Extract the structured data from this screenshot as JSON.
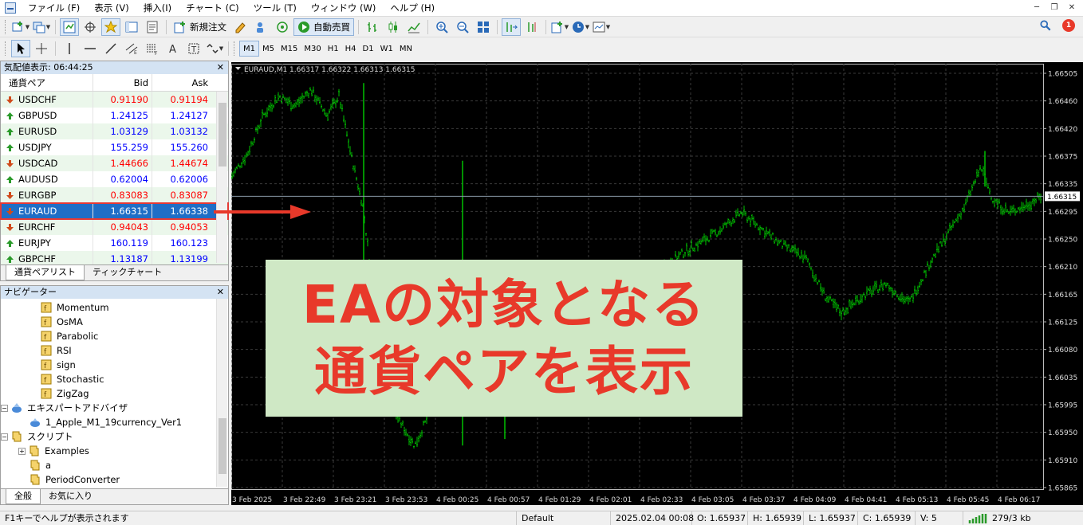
{
  "menubar": {
    "items": [
      "ファイル (F)",
      "表示 (V)",
      "挿入(I)",
      "チャート (C)",
      "ツール (T)",
      "ウィンドウ (W)",
      "ヘルプ (H)"
    ]
  },
  "toolbar": {
    "new_order_label": "新規注文",
    "auto_trade_label": "自動売買",
    "timeframes": [
      "M1",
      "M5",
      "M15",
      "M30",
      "H1",
      "H4",
      "D1",
      "W1",
      "MN"
    ],
    "active_timeframe": "M1",
    "alert_count": "1"
  },
  "market_watch": {
    "title": "気配値表示: 06:44:25",
    "columns": {
      "symbol": "通貨ペア",
      "bid": "Bid",
      "ask": "Ask"
    },
    "rows": [
      {
        "symbol": "USDCHF",
        "bid": "0.91190",
        "ask": "0.91194",
        "dir": "down"
      },
      {
        "symbol": "GBPUSD",
        "bid": "1.24125",
        "ask": "1.24127",
        "dir": "up"
      },
      {
        "symbol": "EURUSD",
        "bid": "1.03129",
        "ask": "1.03132",
        "dir": "up"
      },
      {
        "symbol": "USDJPY",
        "bid": "155.259",
        "ask": "155.260",
        "dir": "up"
      },
      {
        "symbol": "USDCAD",
        "bid": "1.44666",
        "ask": "1.44674",
        "dir": "down"
      },
      {
        "symbol": "AUDUSD",
        "bid": "0.62004",
        "ask": "0.62006",
        "dir": "up"
      },
      {
        "symbol": "EURGBP",
        "bid": "0.83083",
        "ask": "0.83087",
        "dir": "down"
      },
      {
        "symbol": "EURAUD",
        "bid": "1.66315",
        "ask": "1.66338",
        "dir": "down",
        "selected": true
      },
      {
        "symbol": "EURCHF",
        "bid": "0.94043",
        "ask": "0.94053",
        "dir": "down"
      },
      {
        "symbol": "EURJPY",
        "bid": "160.119",
        "ask": "160.123",
        "dir": "up"
      },
      {
        "symbol": "GBPCHF",
        "bid": "1.13187",
        "ask": "1.13199",
        "dir": "up"
      }
    ],
    "tabs": [
      "通貨ペアリスト",
      "ティックチャート"
    ]
  },
  "navigator": {
    "title": "ナビゲーター",
    "items": [
      {
        "label": "Momentum",
        "level": 3,
        "kind": "indicator"
      },
      {
        "label": "OsMA",
        "level": 3,
        "kind": "indicator"
      },
      {
        "label": "Parabolic",
        "level": 3,
        "kind": "indicator"
      },
      {
        "label": "RSI",
        "level": 3,
        "kind": "indicator"
      },
      {
        "label": "sign",
        "level": 3,
        "kind": "indicator"
      },
      {
        "label": "Stochastic",
        "level": 3,
        "kind": "indicator"
      },
      {
        "label": "ZigZag",
        "level": 3,
        "kind": "indicator"
      },
      {
        "label": "エキスパートアドバイザ",
        "level": 1,
        "kind": "ea-folder",
        "expander": "−"
      },
      {
        "label": "1_Apple_M1_19currency_Ver1",
        "level": 2,
        "kind": "ea"
      },
      {
        "label": "スクリプト",
        "level": 1,
        "kind": "script-folder",
        "expander": "−"
      },
      {
        "label": "Examples",
        "level": 2,
        "kind": "script",
        "expander": "+"
      },
      {
        "label": "a",
        "level": 2,
        "kind": "script"
      },
      {
        "label": "PeriodConverter",
        "level": 2,
        "kind": "script"
      }
    ],
    "tabs": [
      "全般",
      "お気に入り"
    ]
  },
  "chart": {
    "header": "EURAUD,M1  1.66317 1.66322 1.66313 1.66315",
    "price_labels": [
      "1.66505",
      "1.66460",
      "1.66420",
      "1.66375",
      "1.66335",
      "1.66295",
      "1.66250",
      "1.66210",
      "1.66165",
      "1.66125",
      "1.66080",
      "1.66035",
      "1.65995",
      "1.65950",
      "1.65910",
      "1.65865"
    ],
    "current_price": "1.66315",
    "time_labels": [
      "3 Feb 2025",
      "3 Feb 22:49",
      "3 Feb 23:21",
      "3 Feb 23:53",
      "4 Feb 00:25",
      "4 Feb 00:57",
      "4 Feb 01:29",
      "4 Feb 02:01",
      "4 Feb 02:33",
      "4 Feb 03:05",
      "4 Feb 03:37",
      "4 Feb 04:09",
      "4 Feb 04:41",
      "4 Feb 05:13",
      "4 Feb 05:45",
      "4 Feb 06:17"
    ],
    "bar_color": "#00c000",
    "background": "#000000",
    "grid_color": "#3a3a3a"
  },
  "callout": {
    "line1": "EAの対象となる",
    "line2": "通貨ペアを表示",
    "background": "#cfe8c5",
    "text_color": "#e8392a"
  },
  "statusbar": {
    "help": "F1キーでヘルプが表示されます",
    "profile": "Default",
    "datetime": "2025.02.04 00:08",
    "open": "O: 1.65937",
    "high": "H: 1.65939",
    "low": "L: 1.65937",
    "close": "C: 1.65939",
    "volume": "V: 5",
    "traffic": "279/3 kb"
  },
  "colors": {
    "bid_up": "#0000ff",
    "bid_down": "#ff0000",
    "selection": "#1f6ec6",
    "highlight_border": "#e53935"
  }
}
